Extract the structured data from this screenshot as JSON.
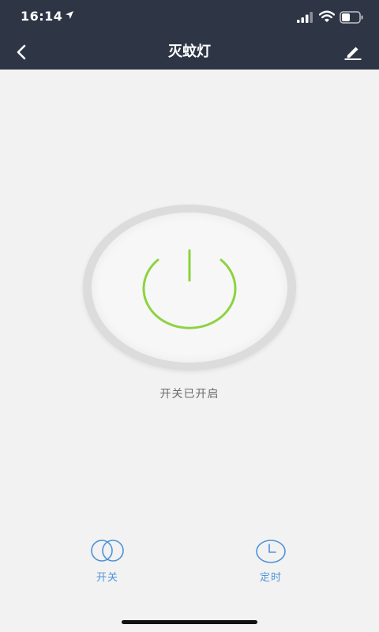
{
  "status_bar": {
    "time": "16:14",
    "icons": [
      "location-arrow-icon",
      "signal-icon",
      "wifi-icon",
      "battery-icon"
    ]
  },
  "nav": {
    "back_icon": "chevron-left-icon",
    "title": "灭蚊灯",
    "edit_icon": "pencil-icon"
  },
  "power": {
    "icon": "power-icon",
    "status_text": "开关已开启"
  },
  "actions": [
    {
      "icon": "toggle-circles-icon",
      "label": "开关"
    },
    {
      "icon": "clock-icon",
      "label": "定时"
    }
  ],
  "colors": {
    "header_bg": "#2e3646",
    "page_bg": "#f2f2f2",
    "power_green": "#8cd33f",
    "accent_blue": "#4e93d9",
    "status_text": "#6b6b6b"
  }
}
